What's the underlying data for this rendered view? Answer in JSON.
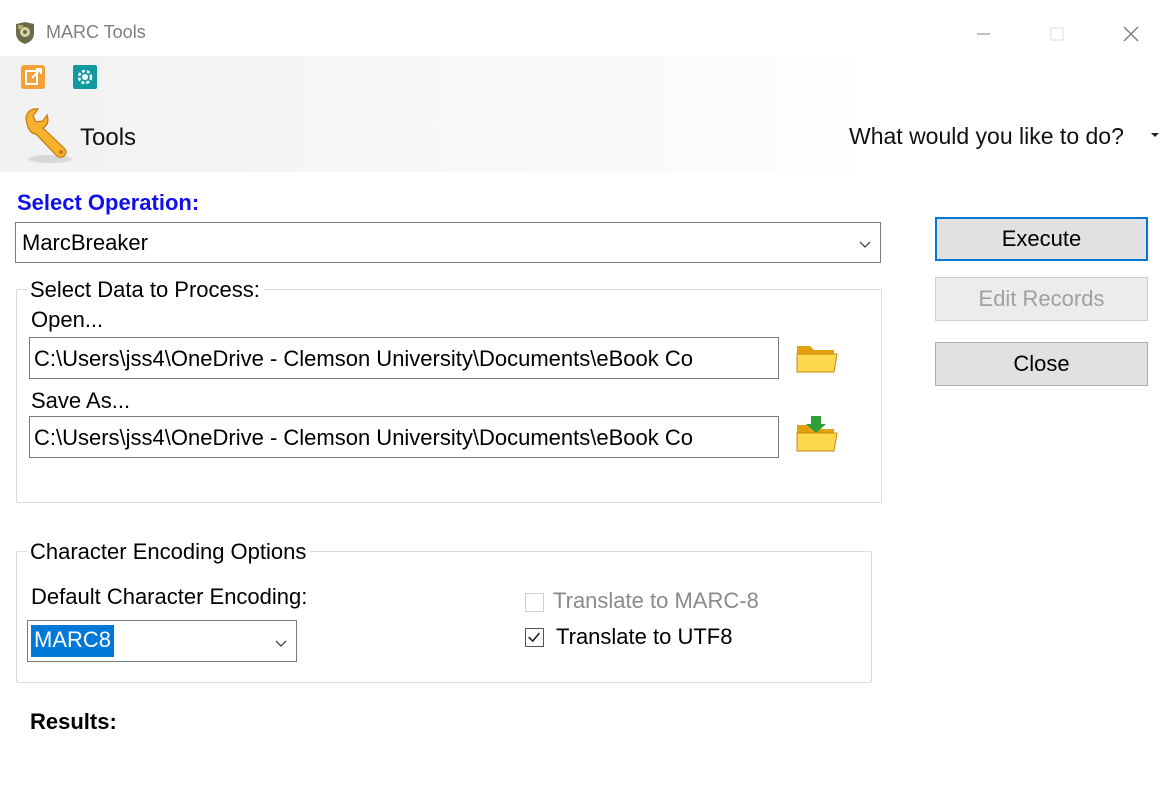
{
  "window": {
    "title": "MARC Tools",
    "icon": "gear-shield-icon"
  },
  "ribbon": {
    "quick_access": [
      "export-icon",
      "settings-gear-icon"
    ],
    "tab_label": "Tools",
    "search_prompt": "What would you like to do?"
  },
  "operation": {
    "label": "Select Operation:",
    "selected": "MarcBreaker"
  },
  "buttons": {
    "execute": "Execute",
    "edit_records": "Edit Records",
    "close": "Close"
  },
  "data_group": {
    "title": "Select Data to Process:",
    "open_label": "Open...",
    "open_path": "C:\\Users\\jss4\\OneDrive - Clemson University\\Documents\\eBook Co",
    "save_label": "Save As...",
    "save_path": "C:\\Users\\jss4\\OneDrive - Clemson University\\Documents\\eBook Co"
  },
  "encoding_group": {
    "title": "Character Encoding Options",
    "default_label": "Default Character Encoding:",
    "default_value": "MARC8",
    "translate_marc8_label": "Translate to MARC-8",
    "translate_marc8_checked": false,
    "translate_marc8_enabled": false,
    "translate_utf8_label": "Translate to UTF8",
    "translate_utf8_checked": true
  },
  "results": {
    "label": "Results:"
  },
  "colors": {
    "accent_blue": "#0078d7",
    "operation_label": "#1010ee"
  }
}
